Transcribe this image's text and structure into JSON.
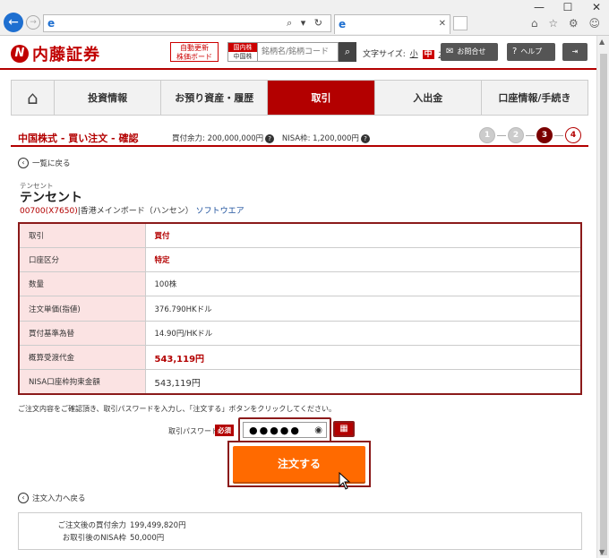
{
  "browser": {
    "window_controls": [
      "—",
      "☐",
      "✕"
    ],
    "address_value": "",
    "address_icon": "ie-icon",
    "addr_tools": "⌕ ▾ ↻",
    "tab_title": "",
    "tab_close": "✕",
    "right_tools": "⌂ ☆ ⚙ ☺"
  },
  "header": {
    "logo_mark": "N",
    "logo_text": "内藤証券",
    "auto_update_line1": "自動更新",
    "auto_update_line2": "株価ボード",
    "market_top": "国内株",
    "market_bottom": "中国株",
    "search_placeholder": "銘柄名/銘柄コード",
    "search_icon": "🔍",
    "font_size_label": "文字サイズ:",
    "font_small": "小",
    "font_mid": "中",
    "font_large": "大",
    "contact_label": "お問合せ",
    "help_label": "ヘルプ",
    "logout_icon": "⇥"
  },
  "nav": {
    "home_icon": "⌂",
    "items": [
      "投資情報",
      "お預り資産・履歴",
      "取引",
      "入出金",
      "口座情報/手続き"
    ],
    "active_index": 2
  },
  "title": {
    "main": "中国株式 - 買い注文 - 確認",
    "buying_power_label": "買付余力: 200,000,000円",
    "nisa_label": "NISA枠: 1,200,000円",
    "steps": [
      "1",
      "2",
      "3",
      "4"
    ],
    "current_step": 3
  },
  "back_to_list": "一覧に戻る",
  "stock": {
    "kana": "テンセント",
    "name": "テンセント",
    "code": "00700(X7650)",
    "market": "|香港メインボード（ハンセン）",
    "sector": "ソフトウエア"
  },
  "table": [
    {
      "key": "取引",
      "value": "買付",
      "style": "red"
    },
    {
      "key": "口座区分",
      "value": "特定",
      "style": "red"
    },
    {
      "key": "数量",
      "value": "100株",
      "style": ""
    },
    {
      "key": "注文単価(指値)",
      "value": "376.790HKドル",
      "style": ""
    },
    {
      "key": "買付基準為替",
      "value": "14.90円/HKドル",
      "style": ""
    },
    {
      "key": "概算受渡代金",
      "value": "543,119円",
      "style": "red big"
    },
    {
      "key": "NISA口座枠拘束金額",
      "value": "543,119円",
      "style": "big"
    }
  ],
  "instruction": "ご注文内容をご確認頂き、取引パスワードを入力し、「注文する」ボタンをクリックしてください。",
  "password": {
    "label": "取引パスワード",
    "required": "必須",
    "value": "●●●●●",
    "eye_icon": "👁",
    "keyboard_icon": "⌨"
  },
  "submit_label": "注文する",
  "back_to_input": "注文入力へ戻る",
  "summary": {
    "buying_power_after_label": "ご注文後の買付余力",
    "buying_power_after_value": "199,499,820円",
    "nisa_after_label": "お取引後のNISA枠",
    "nisa_after_value": "50,000円"
  }
}
